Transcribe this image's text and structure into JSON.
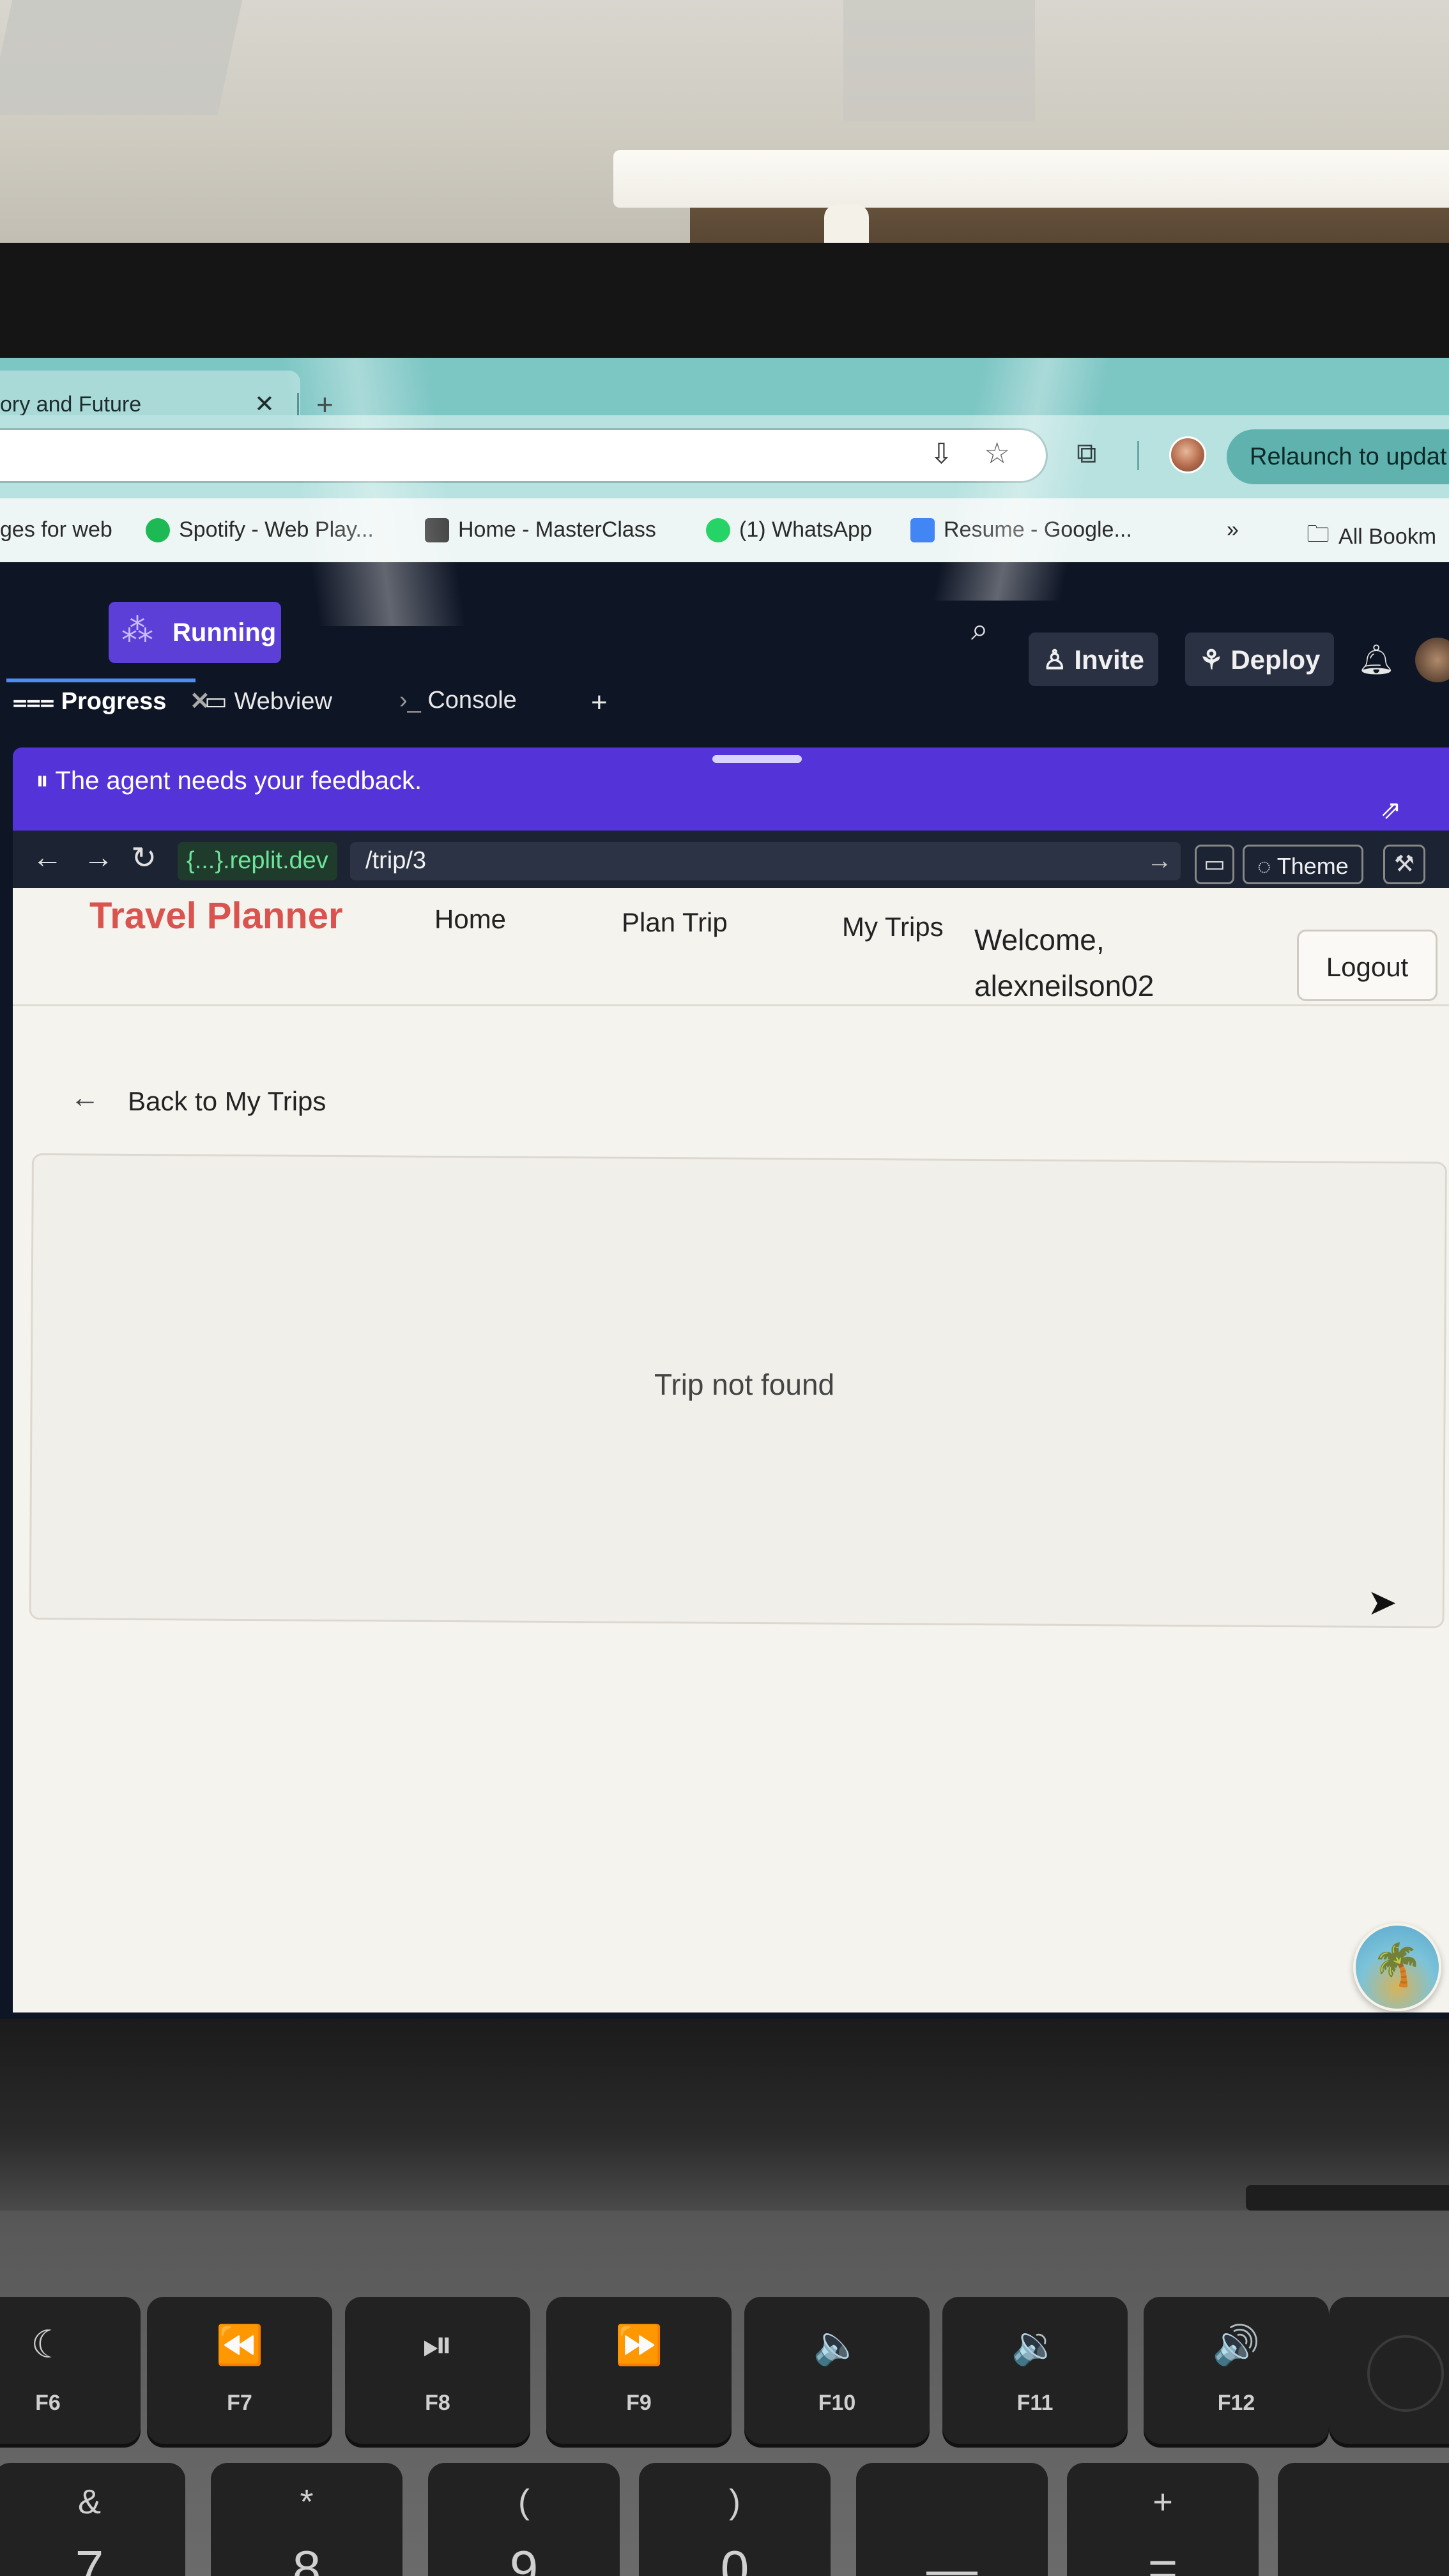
{
  "browser": {
    "tab_title": "ory and Future",
    "tab_close": "✕",
    "new_tab": "+",
    "relaunch_label": "Relaunch to updat",
    "bookmarks": [
      {
        "label": "ges for web",
        "icon": "none"
      },
      {
        "label": "Spotify - Web Play...",
        "icon": "spotify-icon",
        "color": "#1db954"
      },
      {
        "label": "Home - MasterClass",
        "icon": "masterclass-icon",
        "color": "#444444"
      },
      {
        "label": "(1) WhatsApp",
        "icon": "whatsapp-icon",
        "color": "#25d366"
      },
      {
        "label": "Resume - Google...",
        "icon": "google-docs-icon",
        "color": "#4285f4"
      }
    ],
    "bookmarks_overflow": "»",
    "all_bookmarks": "All Bookm"
  },
  "workspace": {
    "running_label": "Running",
    "invite_label": "Invite",
    "deploy_label": "Deploy",
    "pane_tabs": [
      {
        "label": "Progress",
        "icon": "progress-icon",
        "closable": true
      },
      {
        "label": "Webview",
        "icon": "monitor-icon"
      },
      {
        "label": "Console",
        "icon": "terminal-icon"
      }
    ],
    "add_pane": "+",
    "accent": "#5433d9"
  },
  "feedback": {
    "text": "The agent needs your feedback."
  },
  "webview": {
    "url_domain": "{...}.replit.dev",
    "url_path": "/trip/3",
    "theme_label": "Theme"
  },
  "app": {
    "brand": "Travel Planner",
    "brand_color": "#d9534f",
    "nav": [
      "Home",
      "Plan Trip",
      "My Trips"
    ],
    "welcome_line1": "Welcome,",
    "welcome_line2": "alexneilson02",
    "logout_label": "Logout",
    "back_label": "Back to My Trips",
    "empty_message": "Trip not found"
  },
  "keyboard": {
    "function_keys": [
      {
        "symbol": "☾",
        "label": "F6"
      },
      {
        "symbol": "⏪",
        "label": "F7"
      },
      {
        "symbol": "⏯",
        "label": "F8"
      },
      {
        "symbol": "⏩",
        "label": "F9"
      },
      {
        "symbol": "🔈",
        "label": "F10"
      },
      {
        "symbol": "🔉",
        "label": "F11"
      },
      {
        "symbol": "🔊",
        "label": "F12"
      }
    ],
    "number_keys": [
      {
        "top": "&",
        "bottom": "7"
      },
      {
        "top": "*",
        "bottom": "8"
      },
      {
        "top": "(",
        "bottom": "9"
      },
      {
        "top": ")",
        "bottom": "0"
      },
      {
        "top": "",
        "bottom": "—"
      },
      {
        "top": "+",
        "bottom": "="
      }
    ]
  }
}
